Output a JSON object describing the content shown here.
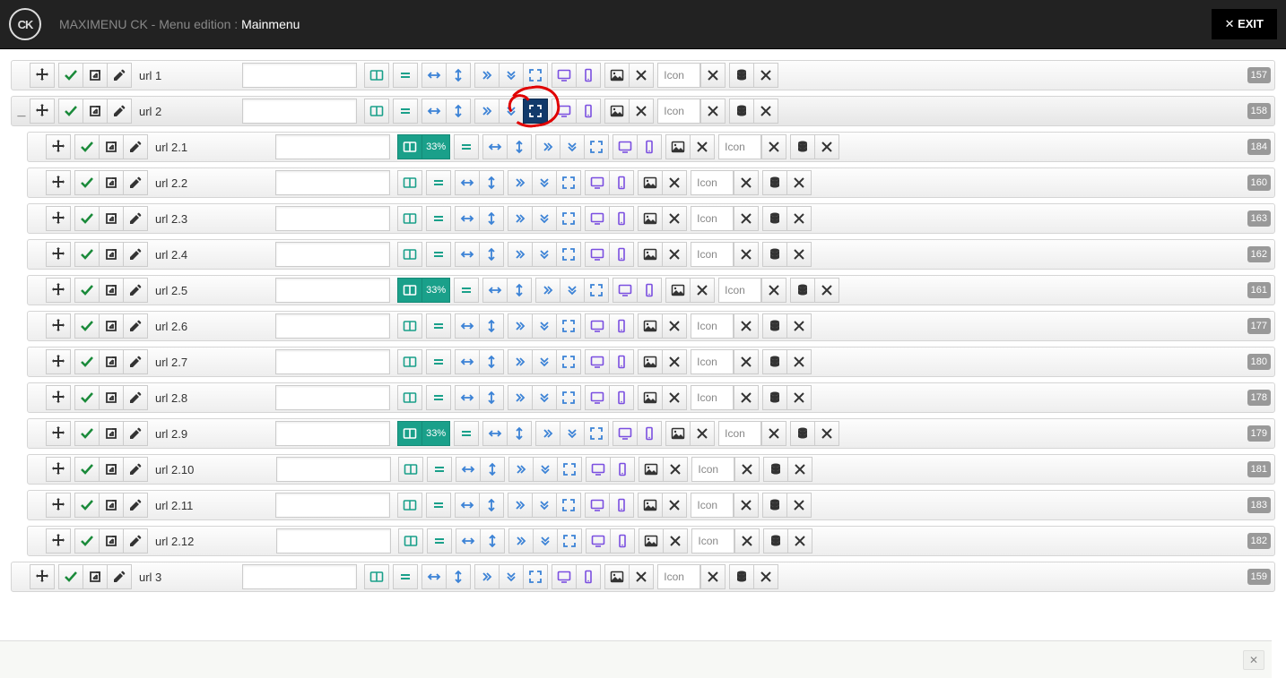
{
  "header": {
    "app_title_prefix": "MAXIMENU CK - Menu edition : ",
    "menu_name": "Mainmenu",
    "logo_text": "CK",
    "exit_label": "EXIT"
  },
  "icon_field_placeholder": "Icon",
  "rows": [
    {
      "label": "url 1",
      "level": 0,
      "collapse": "",
      "id": "157",
      "col_active": false,
      "col_pct": null,
      "full_active": false
    },
    {
      "label": "url 2",
      "level": 0,
      "collapse": "_",
      "id": "158",
      "col_active": false,
      "col_pct": null,
      "full_active": true
    },
    {
      "label": "url 2.1",
      "level": 1,
      "collapse": "",
      "id": "184",
      "col_active": true,
      "col_pct": "33%",
      "full_active": false
    },
    {
      "label": "url 2.2",
      "level": 1,
      "collapse": "",
      "id": "160",
      "col_active": false,
      "col_pct": null,
      "full_active": false
    },
    {
      "label": "url 2.3",
      "level": 1,
      "collapse": "",
      "id": "163",
      "col_active": false,
      "col_pct": null,
      "full_active": false
    },
    {
      "label": "url 2.4",
      "level": 1,
      "collapse": "",
      "id": "162",
      "col_active": false,
      "col_pct": null,
      "full_active": false
    },
    {
      "label": "url 2.5",
      "level": 1,
      "collapse": "",
      "id": "161",
      "col_active": true,
      "col_pct": "33%",
      "full_active": false
    },
    {
      "label": "url 2.6",
      "level": 1,
      "collapse": "",
      "id": "177",
      "col_active": false,
      "col_pct": null,
      "full_active": false
    },
    {
      "label": "url 2.7",
      "level": 1,
      "collapse": "",
      "id": "180",
      "col_active": false,
      "col_pct": null,
      "full_active": false
    },
    {
      "label": "url 2.8",
      "level": 1,
      "collapse": "",
      "id": "178",
      "col_active": false,
      "col_pct": null,
      "full_active": false
    },
    {
      "label": "url 2.9",
      "level": 1,
      "collapse": "",
      "id": "179",
      "col_active": true,
      "col_pct": "33%",
      "full_active": false
    },
    {
      "label": "url 2.10",
      "level": 1,
      "collapse": "",
      "id": "181",
      "col_active": false,
      "col_pct": null,
      "full_active": false
    },
    {
      "label": "url 2.11",
      "level": 1,
      "collapse": "",
      "id": "183",
      "col_active": false,
      "col_pct": null,
      "full_active": false
    },
    {
      "label": "url 2.12",
      "level": 1,
      "collapse": "",
      "id": "182",
      "col_active": false,
      "col_pct": null,
      "full_active": false
    },
    {
      "label": "url 3",
      "level": 0,
      "collapse": "",
      "id": "159",
      "col_active": false,
      "col_pct": null,
      "full_active": false
    }
  ]
}
